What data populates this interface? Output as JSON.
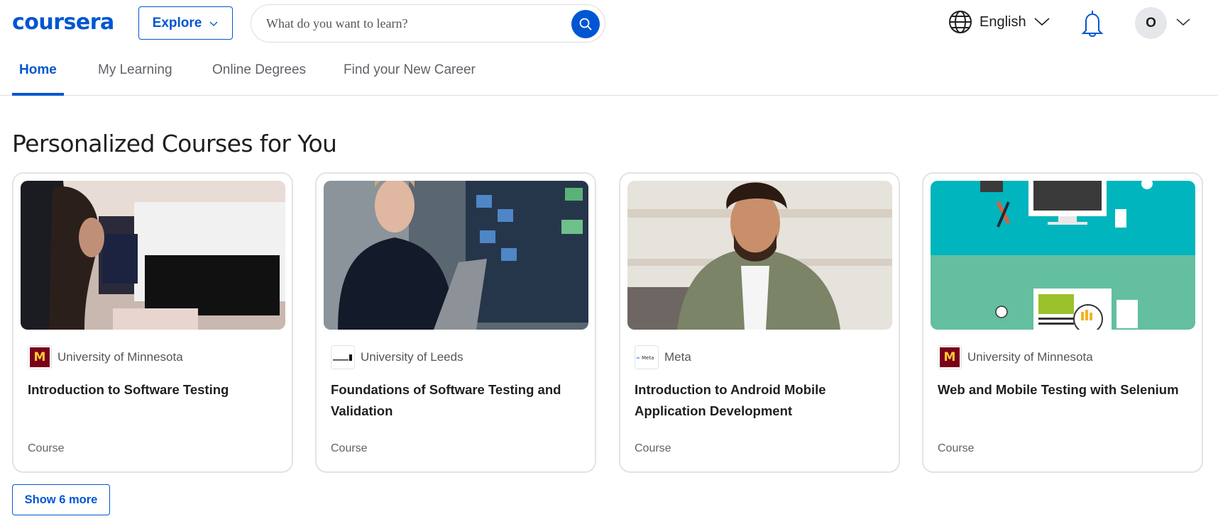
{
  "header": {
    "logo_text": "coursera",
    "explore_label": "Explore",
    "search_placeholder": "What do you want to learn?",
    "language_label": "English",
    "avatar_initial": "O",
    "brand_color": "#0056d2"
  },
  "tabs": [
    {
      "label": "Home",
      "active": true
    },
    {
      "label": "My Learning",
      "active": false
    },
    {
      "label": "Online Degrees",
      "active": false
    },
    {
      "label": "Find your New Career",
      "active": false
    }
  ],
  "section": {
    "title": "Personalized Courses for You",
    "show_more_label": "Show 6 more"
  },
  "courses": [
    {
      "partner": "University of Minnesota",
      "partner_logo": "umn-logo",
      "title": "Introduction to Software Testing",
      "type": "Course",
      "image": "people-at-computers"
    },
    {
      "partner": "University of Leeds",
      "partner_logo": "leeds-logo",
      "title": "Foundations of Software Testing and Validation",
      "type": "Course",
      "image": "woman-with-laptop"
    },
    {
      "partner": "Meta",
      "partner_logo": "meta-logo",
      "title": "Introduction to Android Mobile Application Development",
      "type": "Course",
      "image": "smiling-man-laptop"
    },
    {
      "partner": "University of Minnesota",
      "partner_logo": "umn-logo",
      "title": "Web and Mobile Testing with Selenium",
      "type": "Course",
      "image": "testing-illustration"
    }
  ]
}
